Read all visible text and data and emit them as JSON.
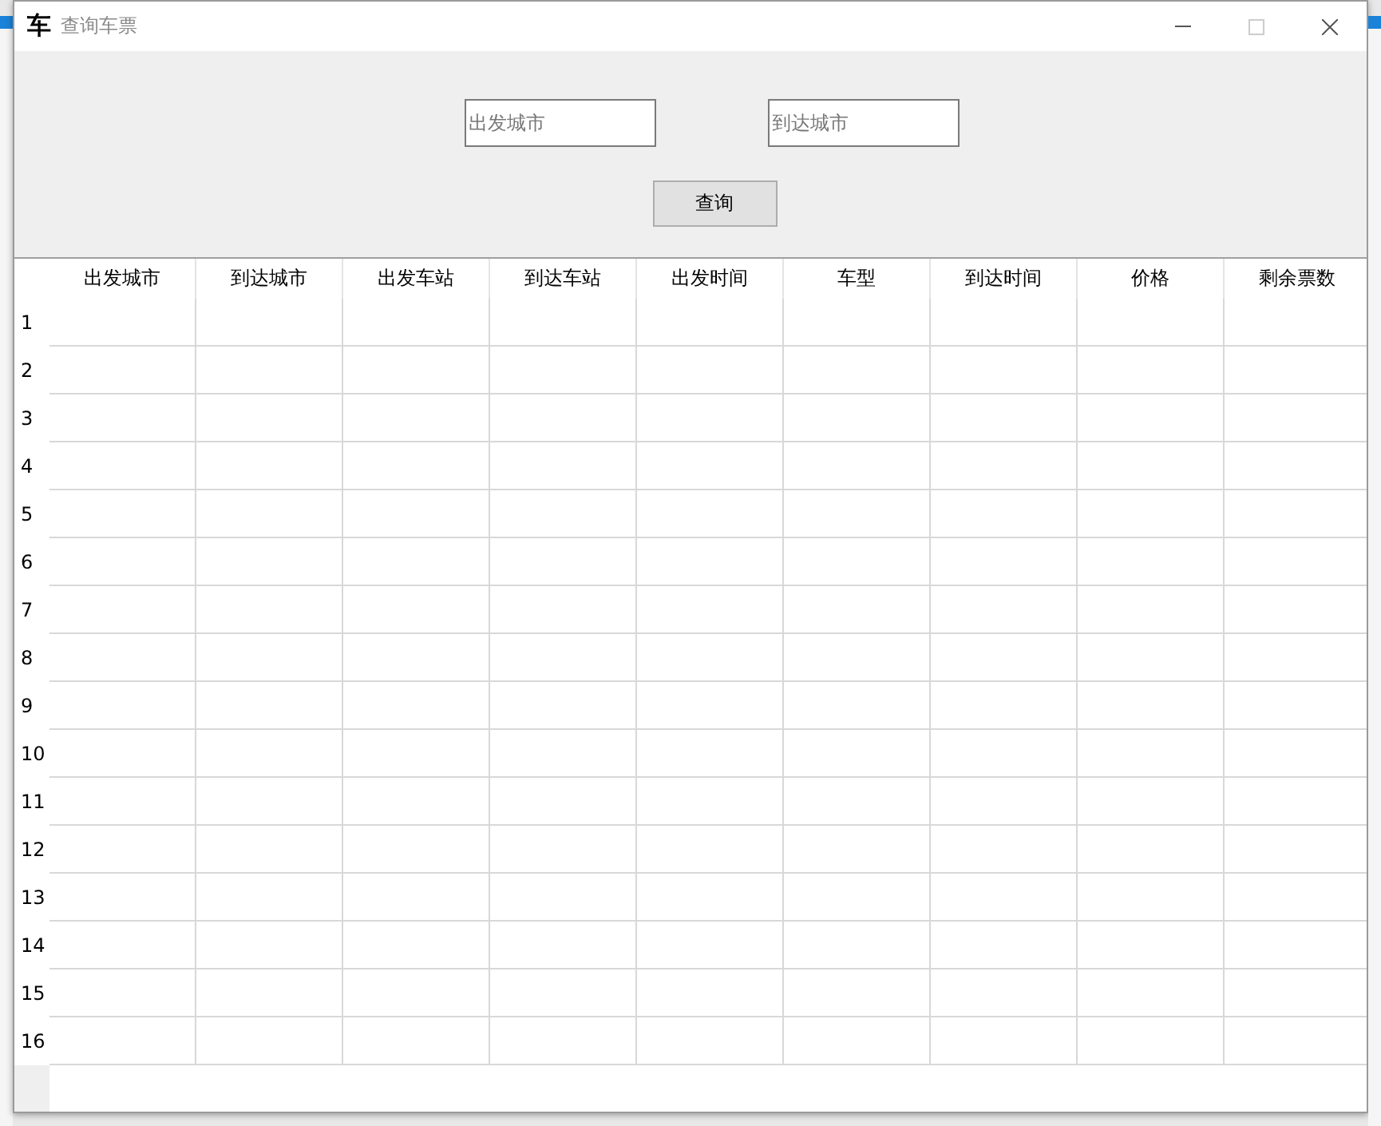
{
  "window": {
    "icon": "车",
    "title": "查询车票"
  },
  "search": {
    "from_field": {
      "placeholder": "出发城市"
    },
    "to_field": {
      "placeholder": "到达城市"
    },
    "button": "查询"
  },
  "table": {
    "columns": [
      "出发城市",
      "到达城市",
      "出发车站",
      "到达车站",
      "出发时间",
      "车型",
      "到达时间",
      "价格",
      "剩余票数"
    ],
    "rows": [
      {
        "number": "1"
      },
      {
        "number": "2"
      },
      {
        "number": "3"
      },
      {
        "number": "4"
      },
      {
        "number": "5"
      },
      {
        "number": "6"
      },
      {
        "number": "7"
      },
      {
        "number": "8"
      },
      {
        "number": "9"
      },
      {
        "number": "10"
      },
      {
        "number": "11"
      },
      {
        "number": "12"
      },
      {
        "number": "13"
      },
      {
        "number": "14"
      },
      {
        "number": "15"
      },
      {
        "number": "16"
      }
    ]
  }
}
